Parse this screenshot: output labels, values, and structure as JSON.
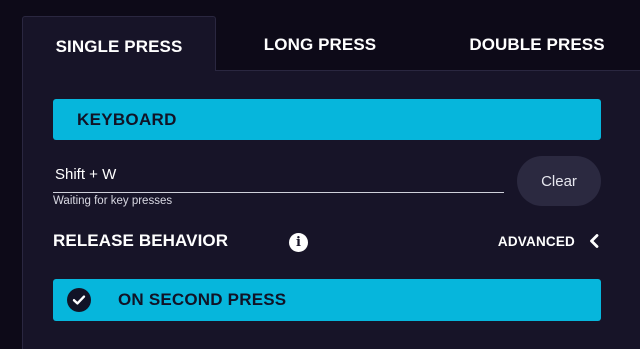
{
  "tabs": [
    {
      "label": "SINGLE PRESS",
      "active": true
    },
    {
      "label": "LONG PRESS",
      "active": false
    },
    {
      "label": "DOUBLE PRESS",
      "active": false
    }
  ],
  "action": {
    "type_label": "KEYBOARD"
  },
  "key_input": {
    "value": "Shift + W",
    "helper": "Waiting for key presses"
  },
  "clear_label": "Clear",
  "release": {
    "title": "RELEASE BEHAVIOR",
    "info_icon": "info-icon",
    "advanced_label": "ADVANCED",
    "advanced_icon": "chevron-left-icon",
    "selected_option": "ON SECOND PRESS",
    "selected_icon": "check-circle-icon"
  },
  "colors": {
    "accent": "#06b6dc",
    "background": "#0d0a18",
    "panel": "#171428"
  }
}
